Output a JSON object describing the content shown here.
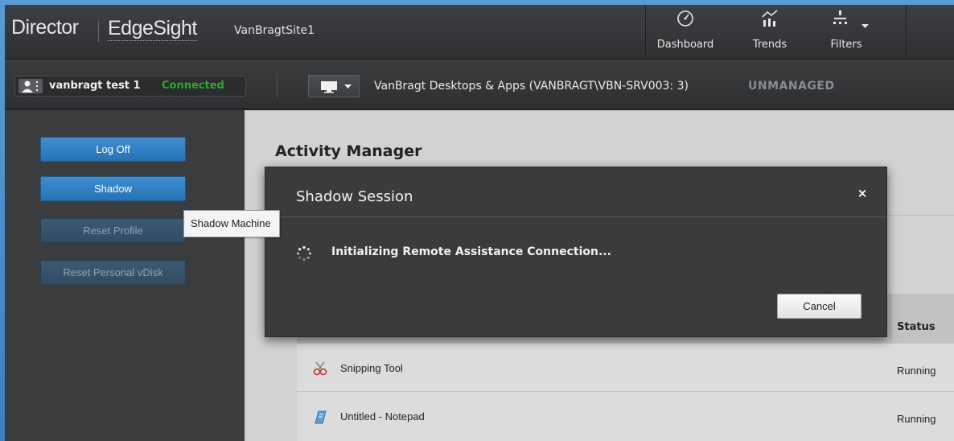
{
  "header": {
    "brand_primary": "Director",
    "brand_secondary": "EdgeSight",
    "site_name": "VanBragtSite1",
    "nav": [
      {
        "label": "Dashboard",
        "icon": "gauge-icon"
      },
      {
        "label": "Trends",
        "icon": "trends-icon"
      },
      {
        "label": "Filters",
        "icon": "filters-icon"
      }
    ]
  },
  "session": {
    "user_name": "vanbragt test 1",
    "user_status": "Connected",
    "machine_name": "VanBragt Desktops & Apps (VANBRAGT\\VBN-SRV003: 3)",
    "machine_state": "UNMANAGED"
  },
  "sidebar": {
    "buttons": [
      {
        "label": "Log Off",
        "enabled": true
      },
      {
        "label": "Shadow",
        "enabled": true
      },
      {
        "label": "Reset Profile",
        "enabled": false
      },
      {
        "label": "Reset Personal vDisk",
        "enabled": false
      }
    ],
    "tooltip": "Shadow Machine"
  },
  "content": {
    "title": "Activity Manager",
    "table": {
      "status_header": "Status",
      "rows": [
        {
          "name": "Snipping Tool",
          "status": "Running",
          "icon": "snipping-tool-icon"
        },
        {
          "name": "Untitled - Notepad",
          "status": "Running",
          "icon": "notepad-icon"
        }
      ]
    }
  },
  "modal": {
    "title": "Shadow Session",
    "close_glyph": "×",
    "message": "Initializing Remote Assistance Connection...",
    "cancel_label": "Cancel"
  },
  "colors": {
    "accent_blue": "#2672b4",
    "connected_green": "#2fa82f",
    "header_bg": "#2e3032",
    "modal_bg": "#3b3b3b"
  }
}
